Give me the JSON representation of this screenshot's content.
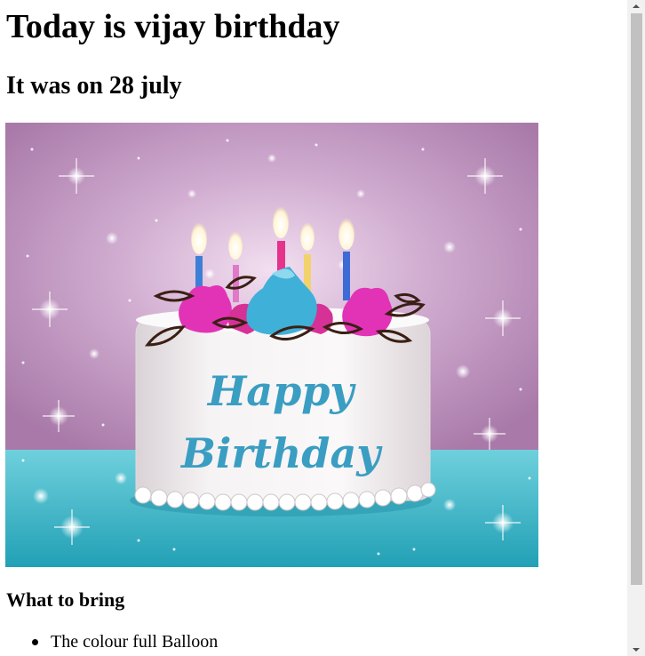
{
  "heading": "Today is vijay birthday",
  "subheading": "It was on 28 july",
  "image": {
    "cake_text_line1": "Happy",
    "cake_text_line2": "Birthday"
  },
  "bring_section": {
    "title": "What to bring",
    "items": [
      "The colour full Balloon"
    ]
  },
  "colors": {
    "background_top": "#b98fb9",
    "table": "#3fb4c6",
    "cake": "#f4f1f1",
    "frosting_pink": "#e033b6",
    "frosting_blue": "#3fb0d8",
    "script_text": "#3a9dc2"
  }
}
